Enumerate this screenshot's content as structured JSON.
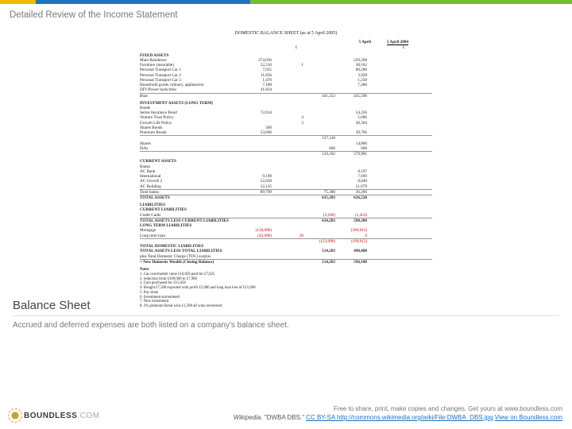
{
  "header": {
    "title": "Detailed Review of the Income Statement"
  },
  "sheet": {
    "title": "DOMESTIC BALANCE SHEET (as at 5 April 2005)",
    "col_left": "5 April",
    "col_right": "5 April 2004",
    "currency": "£",
    "sections": [
      {
        "head": "FIXED ASSETS",
        "rows": [
          {
            "label": "Main Residence",
            "c1": "274,036",
            "c2": "",
            "c3": "",
            "c4": "229,268"
          },
          {
            "label": "Furniture (insurable)",
            "c1": "52,510",
            "c2": "1",
            "c3": "",
            "c4": "38,162"
          },
          {
            "label": "Personal Transport Car 1",
            "c1": "7,625",
            "c2": "",
            "c3": "",
            "c4": "80,200"
          },
          {
            "label": "Personal Transport Car 2",
            "c1": "11,656",
            "c2": "",
            "c3": "",
            "c4": "3,928"
          },
          {
            "label": "Personal Transport Car 3",
            "c1": "1,476",
            "c2": "",
            "c3": "",
            "c4": "1,258"
          },
          {
            "label": "Household goods culinary, appliances)",
            "c1": "7,188",
            "c2": "",
            "c3": "",
            "c4": "7,400"
          },
          {
            "label": "DIY/Power tools/misc",
            "c1": "41,834",
            "c2": "",
            "c3": "",
            "c4": ""
          },
          {
            "label": "Boat",
            "c1": "",
            "c2": "",
            "c3": "441,253",
            "c4": "435,506",
            "total": true
          }
        ]
      },
      {
        "head": "INVESTMENT ASSETS (LONG TERM)",
        "rows": [
          {
            "label": "Bonds",
            "c1": "",
            "c2": "",
            "c3": "",
            "c4": ""
          },
          {
            "label": "Series Insurance Bond",
            "c1": "72,634",
            "c2": "",
            "c3": "",
            "c4": "54,226"
          },
          {
            "label": "Venture Trust Policy",
            "c1": "",
            "c2": "4",
            "c3": "",
            "c4": "5,686"
          },
          {
            "label": "Growth Life Policy",
            "c1": "",
            "c2": "3",
            "c3": "",
            "c4": "30,364"
          },
          {
            "label": "Shares Bonds",
            "c1": "500",
            "c2": "",
            "c3": "",
            "c4": ""
          },
          {
            "label": "Premium Bonds",
            "c1": "53,600",
            "c2": "",
            "c3": "",
            "c4": "39,766"
          },
          {
            "label": "",
            "c1": "",
            "c2": "",
            "c3": "137,140",
            "c4": "",
            "total": true
          },
          {
            "label": "Shares",
            "c1": "",
            "c2": "",
            "c3": "",
            "c4": "14,860"
          },
          {
            "label": "ISAs",
            "c1": "",
            "c2": "",
            "c3": "666",
            "c4": "600"
          },
          {
            "label": "",
            "c1": "",
            "c2": "",
            "c3": "519,182",
            "c4": "579,981",
            "total": true,
            "doubleline": true
          }
        ]
      },
      {
        "head": "CURRENT ASSETS",
        "rows": [
          {
            "label": "Banks",
            "c1": "",
            "c2": "",
            "c3": "",
            "c4": ""
          },
          {
            "label": "AC Bank",
            "c1": "",
            "c2": "",
            "c3": "",
            "c4": "8,107"
          },
          {
            "label": "International",
            "c1": "9,198",
            "c2": "",
            "c3": "",
            "c4": "7,669"
          },
          {
            "label": "AC Growth 2",
            "c1": "52,838",
            "c2": "",
            "c3": "",
            "c4": "8,840"
          },
          {
            "label": "AC Building",
            "c1": "12,125",
            "c2": "",
            "c3": "",
            "c4": "21,679"
          },
          {
            "label": "Total banks",
            "c1": "89,709",
            "c2": "",
            "c3": "75,380",
            "c4": "36,266",
            "total": true
          },
          {
            "label": "TOTAL ASSETS",
            "c1": "",
            "c2": "",
            "c3": "635,383",
            "c4": "626,520",
            "bold": true,
            "total": true
          }
        ]
      },
      {
        "head": "LIABILITIES",
        "rows": [
          {
            "label": "CURRENT LIABILITIES",
            "c1": "",
            "c2": "",
            "c3": "",
            "c4": "",
            "bold": true
          },
          {
            "label": "Credit Cards",
            "c1": "",
            "c2": "",
            "c3": "(5,100)",
            "c4": "(1,453)",
            "neg": true
          },
          {
            "label": "TOTAL ASSETS LESS CURRENT LIABILITIES",
            "c1": "",
            "c2": "",
            "c3": "634,283",
            "c4": "598,300",
            "bold": true,
            "total": true
          },
          {
            "label": "LONG TERM LIABILITIES",
            "c1": "",
            "c2": "",
            "c3": "",
            "c4": "",
            "bold": true
          },
          {
            "label": "Mortgage",
            "c1": "(120,000)",
            "c2": "",
            "c3": "",
            "c4": "(309,812)",
            "neg": true
          },
          {
            "label": "Long term loan",
            "c1": "(42,090)",
            "c2": "29",
            "c3": "",
            "c4": "0",
            "neg": true
          },
          {
            "label": "",
            "c1": "",
            "c2": "",
            "c3": "(123,000)",
            "c4": "(109,812)",
            "neg": true,
            "total": true
          },
          {
            "label": "TOTAL DOMESTIC LIABILITIES",
            "c1": "",
            "c2": "",
            "c3": "",
            "c4": "",
            "bold": true
          },
          {
            "label": "TOTAL ASSETS LESS TOTAL LIABILITIES",
            "c1": "",
            "c2": "",
            "c3": "514,283",
            "c4": "498,488",
            "bold": true
          },
          {
            "label": "plus Total Domestic Charge (TDC) surplus",
            "c1": "",
            "c2": "",
            "c3": "",
            "c4": ""
          },
          {
            "label": "= New Domestic Wealth (Closing Balance)",
            "c1": "",
            "c2": "",
            "c3": "514,283",
            "c4": "596,188",
            "bold": true,
            "total": true
          }
        ]
      }
    ],
    "notes_head": "Notes",
    "notes": [
      "1.  Car cost/market value £10,858 paid for £7,625",
      "2.  reduction from £109,000 to £7,900",
      "3.  Cars purchased for £15,658",
      "4.  Bought £7,500 expected with profit £1,000 and long loan loss of £21,090",
      "5.  Pay share",
      "6.  Investment surrendered",
      "7.  New investment",
      "8.  3% premium Bond wins £1,508 all wins reinvested"
    ]
  },
  "caption": {
    "title": "Balance Sheet",
    "text": "Accrued and deferred expenses are both listed on a company's balance sheet."
  },
  "footer": {
    "free": "Free to share, print, make copies and changes. Get yours at www.boundless.com",
    "cred_src": "Wikipedia.",
    "cred_q1": "\"DWBA DBS.\" ",
    "cred_lic": "CC BY-SA ",
    "cred_url": "http://commons.wikimedia.org/wiki/File:DWBA_DBS.jpg",
    "cred_view": " View on Boundless.com",
    "logo": "BOUNDLESS",
    "logo_suffix": ".COM"
  }
}
